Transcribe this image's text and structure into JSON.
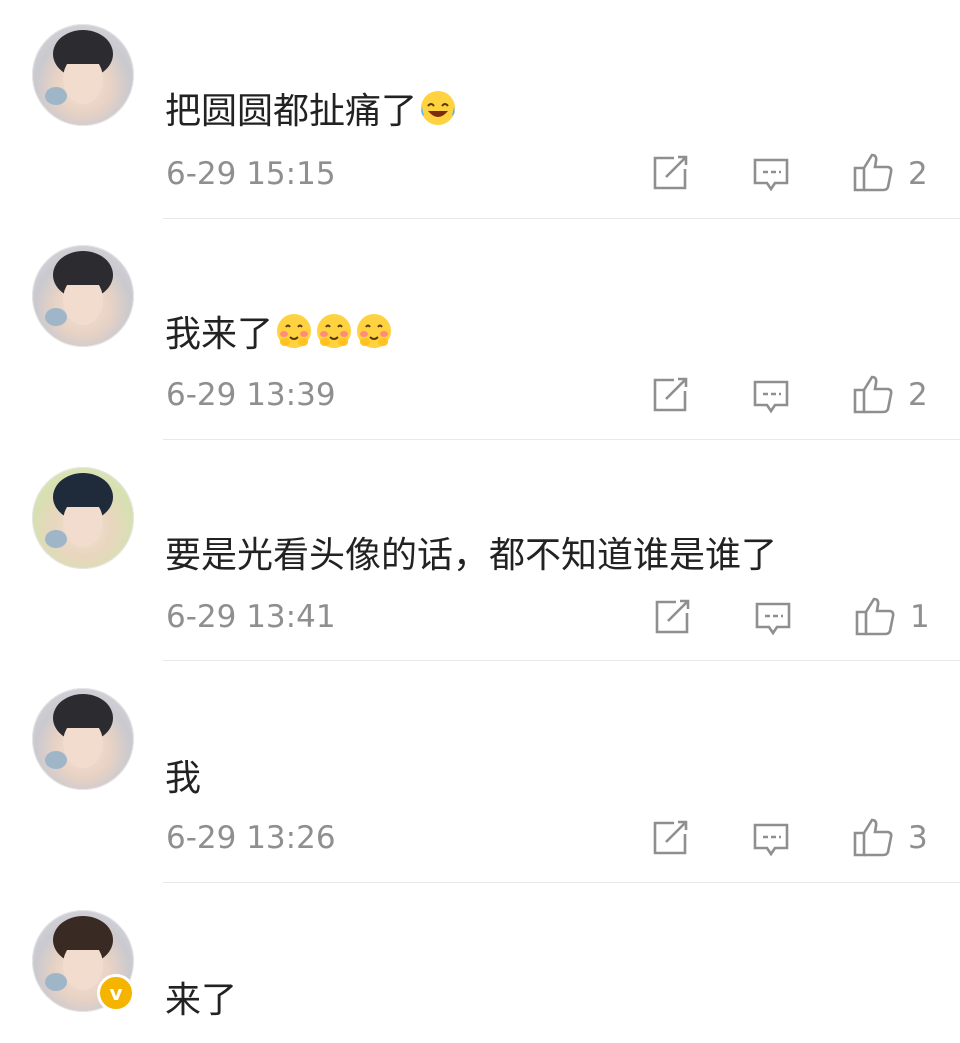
{
  "comments": [
    {
      "text": "把圆圆都扯痛了",
      "emojis": [
        "laugh-cry-emoji"
      ],
      "time": "6-29 15:15",
      "likes": "2"
    },
    {
      "text": "我来了",
      "emojis": [
        "blush-emoji",
        "blush-emoji",
        "blush-emoji"
      ],
      "time": "6-29 13:39",
      "likes": "2"
    },
    {
      "text": "要是光看头像的话，都不知道谁是谁了",
      "emojis": [],
      "time": "6-29 13:41",
      "likes": "1"
    },
    {
      "text": "我",
      "emojis": [],
      "time": "6-29 13:26",
      "likes": "3"
    },
    {
      "text": "来了",
      "emojis": [],
      "time": "",
      "likes": ""
    }
  ],
  "badge": {
    "label": "v"
  },
  "colors": {
    "text": "#222222",
    "meta": "#8f8f8f",
    "divider": "#e8e8e8",
    "badge": "#f5b400"
  },
  "icons": [
    "share-icon",
    "comment-icon",
    "like-icon"
  ]
}
